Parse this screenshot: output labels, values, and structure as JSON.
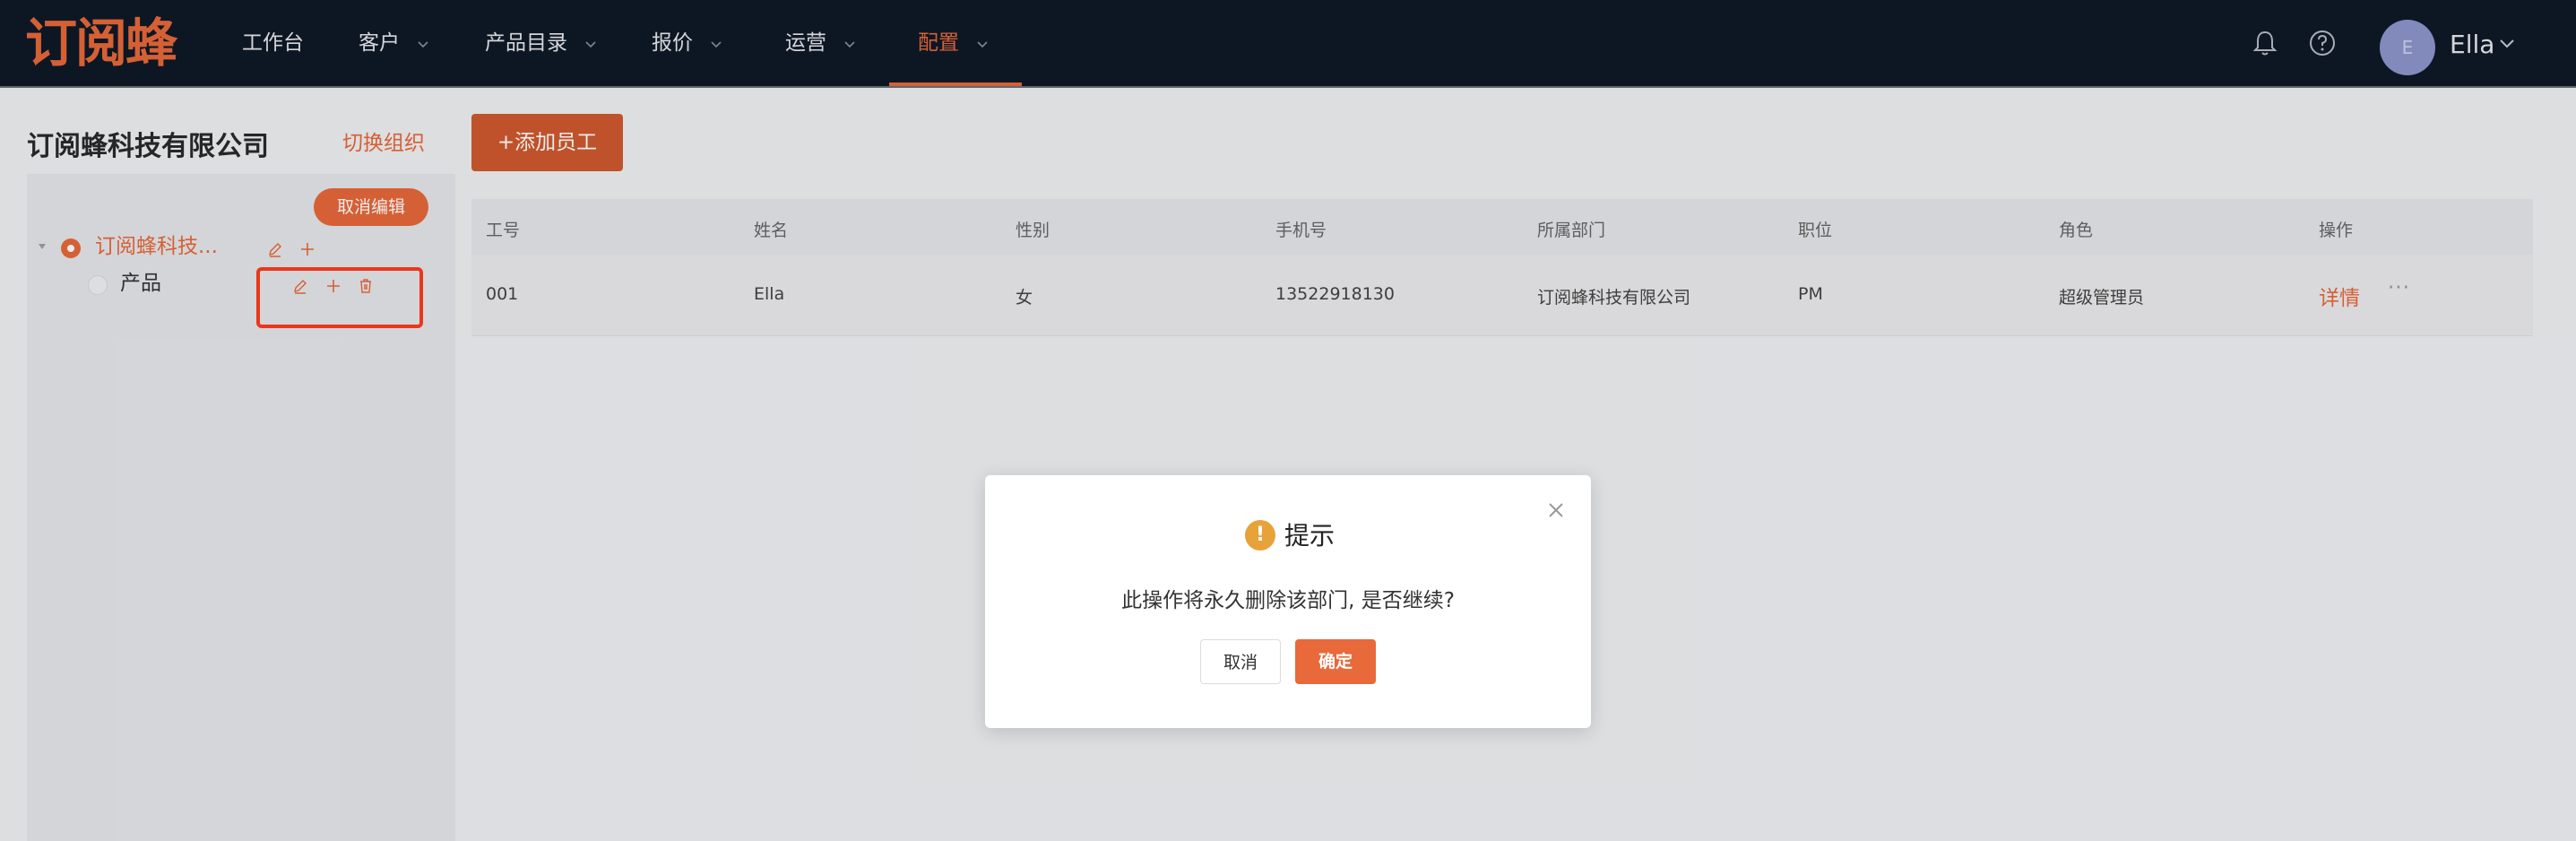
{
  "brand": {
    "logo_text": "订阅蜂",
    "accent": "#e8693a",
    "nav_bg": "#0f1a28"
  },
  "nav": {
    "items": [
      {
        "label": "工作台",
        "has_dropdown": false
      },
      {
        "label": "客户",
        "has_dropdown": true
      },
      {
        "label": "产品目录",
        "has_dropdown": true
      },
      {
        "label": "报价",
        "has_dropdown": true
      },
      {
        "label": "运营",
        "has_dropdown": true
      },
      {
        "label": "配置",
        "has_dropdown": true,
        "active": true
      }
    ],
    "icons": [
      "bell-icon",
      "help-icon"
    ],
    "user": {
      "avatar_initial": "E",
      "name": "Ella"
    }
  },
  "sidebar": {
    "org_name": "订阅蜂科技有限公司",
    "switch_org_label": "切换组织",
    "cancel_edit_label": "取消编辑",
    "tree": {
      "root_label": "订阅蜂科技...",
      "child_label": "产品"
    }
  },
  "main": {
    "add_employee_label": "+添加员工",
    "table": {
      "headers": [
        "工号",
        "姓名",
        "性别",
        "手机号",
        "所属部门",
        "职位",
        "角色",
        "操作"
      ],
      "rows": [
        [
          "001",
          "Ella",
          "女",
          "13522918130",
          "订阅蜂科技有限公司",
          "PM",
          "超级管理员"
        ]
      ],
      "detail_label": "详情",
      "more_label": "···"
    }
  },
  "dialog": {
    "title": "提示",
    "warn_glyph": "!",
    "message": "此操作将永久删除该部门, 是否继续?",
    "cancel_label": "取消",
    "confirm_label": "确定"
  }
}
